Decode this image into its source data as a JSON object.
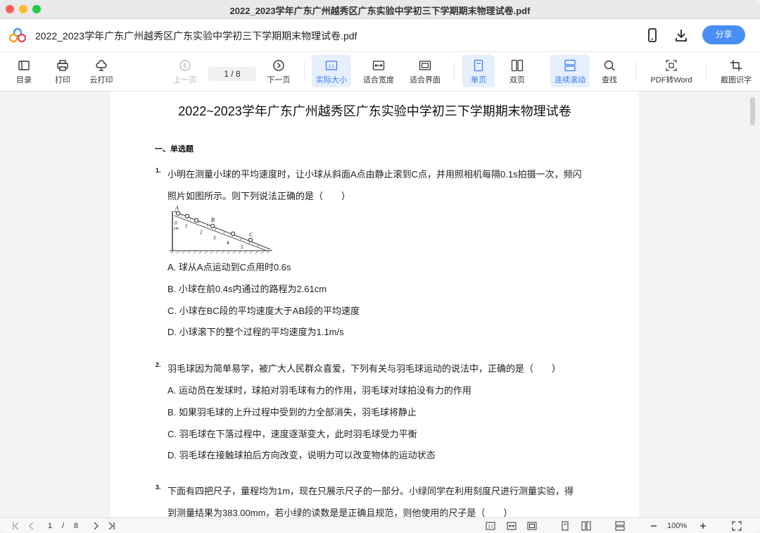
{
  "window": {
    "title": "2022_2023学年广东广州越秀区广东实验中学初三下学期期末物理试卷.pdf"
  },
  "appbar": {
    "filename": "2022_2023学年广东广州越秀区广东实验中学初三下学期期末物理试卷.pdf",
    "share_label": "分享"
  },
  "toolbar": {
    "toc": "目录",
    "print": "打印",
    "cloud_print": "云打印",
    "prev_page": "上一页",
    "page_indicator": "1  /  8",
    "next_page": "下一页",
    "actual_size": "实际大小",
    "fit_width": "适合宽度",
    "fit_page": "适合界面",
    "single_page": "单页",
    "double_page": "双页",
    "continuous": "连续滚动",
    "search": "查找",
    "pdf_to_word": "PDF转Word",
    "ocr": "截图识字"
  },
  "document": {
    "title": "2022~2023学年广东广州越秀区广东实验中学初三下学期期末物理试卷",
    "section": "一、单选题",
    "q1": {
      "num": "1.",
      "line1": "小明在测量小球的平均速度时，让小球从斜面A点由静止滚到C点，并用照相机每隔0.1s拍摄一次，频闪",
      "line2": "照片如图所示。则下列说法正确的是（　　）",
      "figure_labels": {
        "a": "A",
        "b": "B",
        "c": "C",
        "cm": "cm",
        "n0": "0",
        "n1": "1",
        "n2": "2",
        "n3": "3",
        "n4": "4",
        "n5": "5"
      },
      "opt_a": "A. 球从A点运动到C点用时0.6s",
      "opt_b": "B. 小球在前0.4s内通过的路程为2.61cm",
      "opt_c": "C. 小球在BC段的平均速度大于AB段的平均速度",
      "opt_d": "D. 小球滚下的整个过程的平均速度为1.1m/s"
    },
    "q2": {
      "num": "2.",
      "line1": "羽毛球因为简单易学，被广大人民群众喜爱，下列有关与羽毛球运动的说法中，正确的是（　　）",
      "opt_a": "A. 运动员在发球时，球拍对羽毛球有力的作用，羽毛球对球拍没有力的作用",
      "opt_b": "B. 如果羽毛球的上升过程中受到的力全部消失，羽毛球将静止",
      "opt_c": "C. 羽毛球在下落过程中，速度逐渐变大，此时羽毛球受力平衡",
      "opt_d": "D. 羽毛球在接触球拍后方向改变，说明力可以改变物体的运动状态"
    },
    "q3": {
      "num": "3.",
      "line1": "下面有四把尺子，量程均为1m，现在只展示尺子的一部分。小绿同学在利用刻度尺进行测量实验，得",
      "line2": "到测量结果为383.00mm，若小绿的读数是是正确且规范，则他使用的尺子是（　　）"
    }
  },
  "statusbar": {
    "current_page": "1",
    "separator": "/",
    "total_pages": "8",
    "zoom": "100%"
  }
}
